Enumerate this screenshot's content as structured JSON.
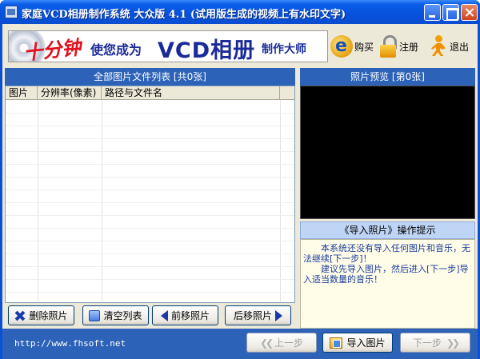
{
  "window": {
    "title": "家庭VCD相册制作系统 大众版 4.1 (试用版生成的视频上有水印文字)"
  },
  "banner": {
    "red_text": "十分钟",
    "blue_text": "使您成为",
    "vcd_text": "VCD相册",
    "tail_text": "制作大师"
  },
  "toolbar": {
    "buy_label": "购买",
    "register_label": "注册",
    "exit_label": "退出"
  },
  "file_list": {
    "header": "全部图片文件列表 [共0张]",
    "columns": [
      "图片",
      "分辨率(像素)",
      "路径与文件名"
    ],
    "rows": []
  },
  "list_buttons": {
    "delete_label": "删除照片",
    "clear_label": "清空列表",
    "move_forward_label": "前移照片",
    "move_back_label": "后移照片"
  },
  "preview": {
    "header": "照片预览 [第0张]"
  },
  "tips": {
    "header": "《导入照片》操作提示",
    "line1": "本系统还没有导入任何图片和音乐，无法继续[下一步]！",
    "line2": "建议先导入图片，然后进入[下一步]导入适当数量的音乐！"
  },
  "status": {
    "url": "http://www.fhsoft.net"
  },
  "nav": {
    "prev_label": "上一步",
    "import_label": "导入图片",
    "next_label": "下一步"
  }
}
